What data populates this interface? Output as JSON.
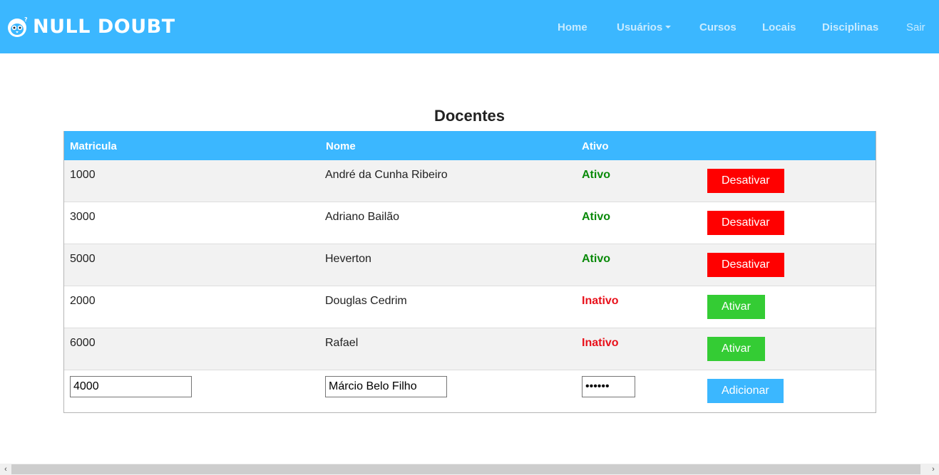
{
  "brand": {
    "name": "NULL DOUBT",
    "icon": "penguin-logo-icon"
  },
  "nav": {
    "home": "Home",
    "usuarios": "Usuários",
    "cursos": "Cursos",
    "locais": "Locais",
    "disciplinas": "Disciplinas",
    "sair": "Sair"
  },
  "page": {
    "title": "Docentes"
  },
  "table": {
    "headers": {
      "matricula": "Matricula",
      "nome": "Nome",
      "ativo": "Ativo"
    },
    "rows": [
      {
        "matricula": "1000",
        "nome": "André da Cunha Ribeiro",
        "status": "Ativo",
        "action": "Desativar"
      },
      {
        "matricula": "3000",
        "nome": "Adriano Bailão",
        "status": "Ativo",
        "action": "Desativar"
      },
      {
        "matricula": "5000",
        "nome": "Heverton",
        "status": "Ativo",
        "action": "Desativar"
      },
      {
        "matricula": "2000",
        "nome": "Douglas Cedrim",
        "status": "Inativo",
        "action": "Ativar"
      },
      {
        "matricula": "6000",
        "nome": "Rafael",
        "status": "Inativo",
        "action": "Ativar"
      }
    ],
    "new_row": {
      "matricula_value": "4000",
      "nome_value": "Márcio Belo Filho",
      "senha_value": "••••••",
      "add_label": "Adicionar"
    }
  },
  "scrollbar": {
    "left_arrow": "‹",
    "right_arrow": "›"
  },
  "colors": {
    "primary": "#3bb7ff",
    "active_text": "#0a8a0a",
    "inactive_text": "#e8111b",
    "danger_button": "#ff0000",
    "success_button": "#34cc34"
  }
}
